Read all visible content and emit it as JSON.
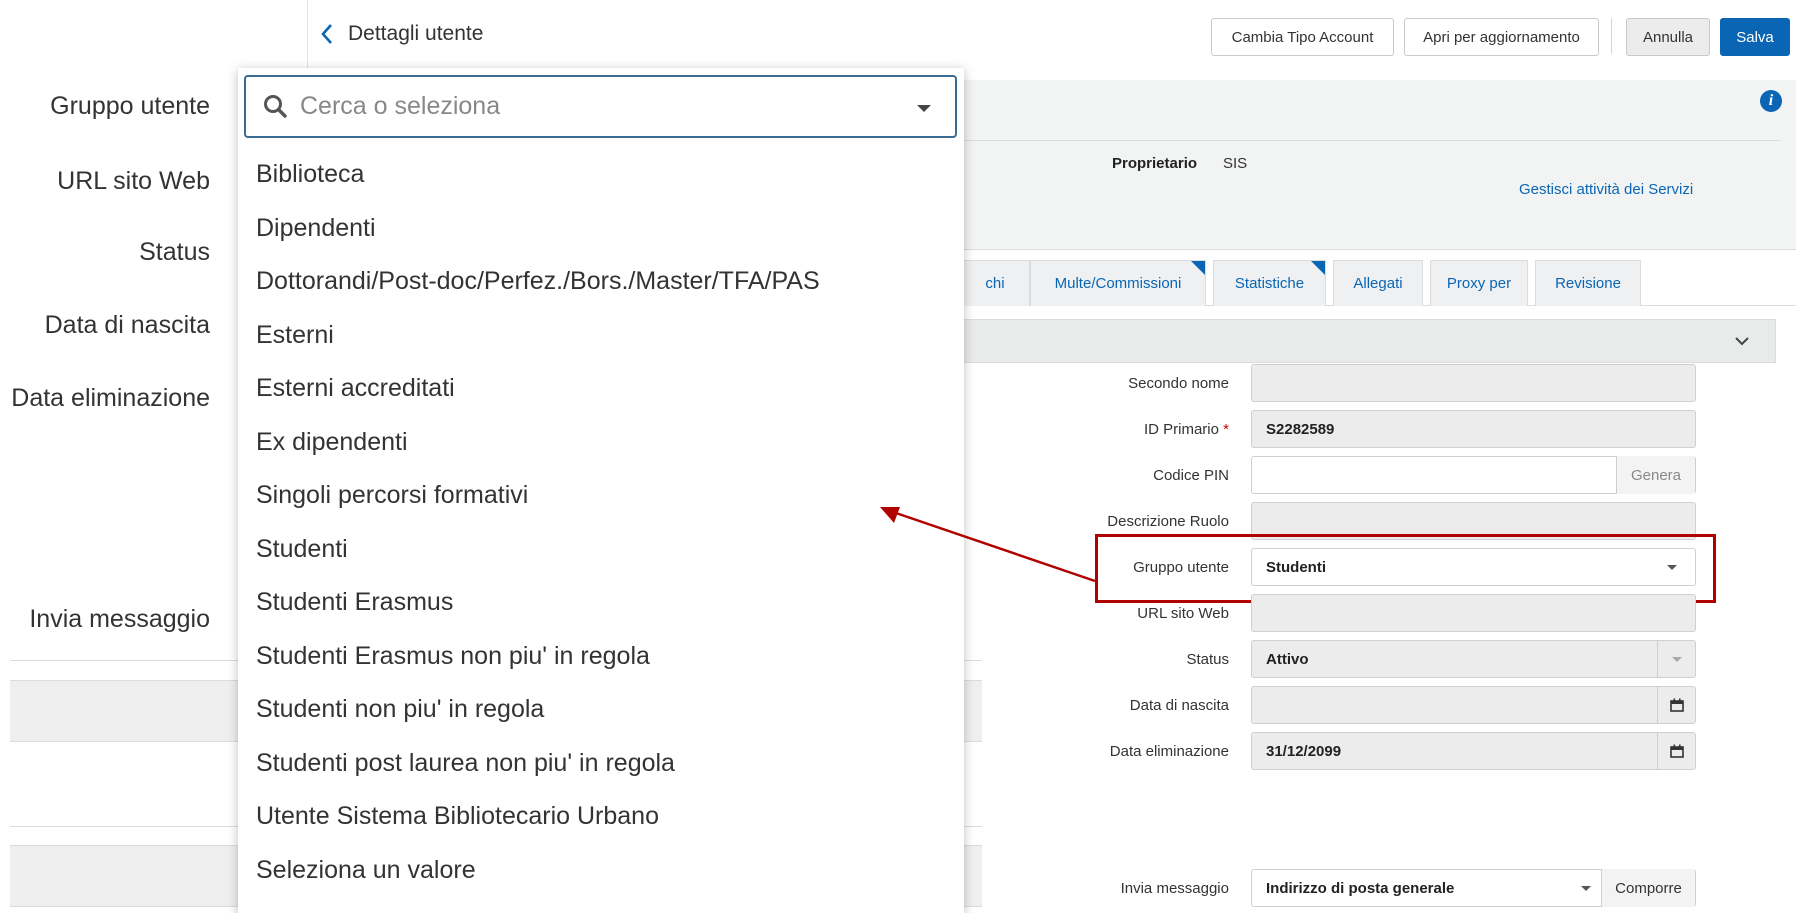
{
  "topbar": {
    "back_label": "Dettagli utente",
    "buttons": {
      "change_account": "Cambia Tipo Account",
      "open_update": "Apri per aggiornamento",
      "cancel": "Annulla",
      "save": "Salva"
    }
  },
  "header": {
    "owner_label": "Proprietario",
    "owner_value": "SIS",
    "services_link": "Gestisci attività dei Servizi"
  },
  "tabs": [
    {
      "label": "chi",
      "has_corner": false
    },
    {
      "label": "Multe/Commissioni",
      "has_corner": true
    },
    {
      "label": "Statistiche",
      "has_corner": true
    },
    {
      "label": "Allegati",
      "has_corner": false
    },
    {
      "label": "Proxy per",
      "has_corner": false
    },
    {
      "label": "Revisione",
      "has_corner": false
    }
  ],
  "form": {
    "second_name": {
      "label": "Secondo nome",
      "value": ""
    },
    "primary_id": {
      "label": "ID Primario",
      "required_mark": "*",
      "value": "S2282589"
    },
    "pin": {
      "label": "Codice PIN",
      "value": "",
      "button": "Genera"
    },
    "role_desc": {
      "label": "Descrizione Ruolo",
      "value": ""
    },
    "user_group": {
      "label": "Gruppo utente",
      "value": "Studenti"
    },
    "website": {
      "label": "URL sito Web",
      "value": ""
    },
    "status": {
      "label": "Status",
      "value": "Attivo"
    },
    "birth_date": {
      "label": "Data di nascita",
      "value": ""
    },
    "purge_date": {
      "label": "Data eliminazione",
      "value": "31/12/2099"
    },
    "send_message": {
      "label": "Invia messaggio",
      "value": "Indirizzo di posta generale",
      "button": "Comporre"
    }
  },
  "left_labels": {
    "user_group": "Gruppo utente",
    "website": "URL sito Web",
    "status": "Status",
    "birth_date": "Data di nascita",
    "purge_date": "Data eliminazione",
    "send_message": "Invia messaggio"
  },
  "dropdown": {
    "placeholder": "Cerca o seleziona",
    "options": [
      "Biblioteca",
      "Dipendenti",
      "Dottorandi/Post-doc/Perfez./Bors./Master/TFA/PAS",
      "Esterni",
      "Esterni accreditati",
      "Ex dipendenti",
      "Singoli percorsi formativi",
      "Studenti",
      "Studenti Erasmus",
      "Studenti Erasmus non piu' in regola",
      "Studenti non piu' in regola",
      "Studenti post laurea non piu' in regola",
      "Utente Sistema Bibliotecario Urbano",
      "Seleziona un valore"
    ]
  },
  "colors": {
    "accent": "#0a66b5",
    "highlight": "#b00000"
  }
}
